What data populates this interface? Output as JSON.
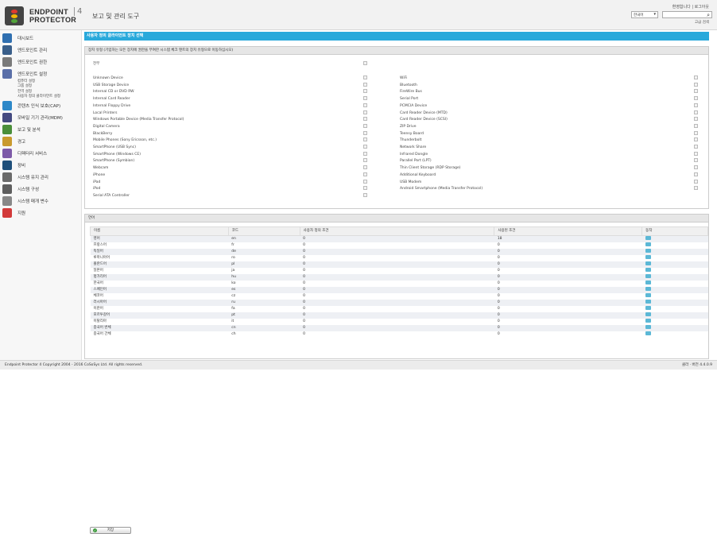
{
  "header": {
    "logo_line1": "ENDPOINT",
    "logo_line2": "PROTECTOR",
    "logo_version": "4",
    "page_title": "보고 및 관리 도구",
    "user_links": "환영합니다 | 로그아웃",
    "lang_select": "한국어",
    "advanced_search": "고급 검색"
  },
  "sidebar": {
    "items": [
      {
        "label": "대시보드",
        "icon": "dashboard-icon",
        "color": "#2f6fb0"
      },
      {
        "label": "엔드포인트 관리",
        "icon": "monitor-icon",
        "color": "#3a5f8a"
      },
      {
        "label": "엔드포인트 권한",
        "icon": "devices-icon",
        "color": "#7a7a7a"
      },
      {
        "label": "엔드포인트 설정",
        "icon": "tools-icon",
        "color": "#5a6fa8"
      }
    ],
    "sub_items": [
      "컴퓨터 설정",
      "그룹 설정",
      "전역 설정",
      "사용자 정의 클라이언트 설정"
    ],
    "items2": [
      {
        "label": "콘텐츠 인식 보호(CAP)",
        "icon": "cap-icon",
        "color": "#2d88c8"
      },
      {
        "label": "모바일 기기 관리(MDM)",
        "icon": "tablet-icon",
        "color": "#444a80"
      },
      {
        "label": "보고 및 분석",
        "icon": "chart-icon",
        "color": "#4a8e3a"
      },
      {
        "label": "경고",
        "icon": "alert-icon",
        "color": "#c99a2e"
      },
      {
        "label": "디렉터리 서비스",
        "icon": "directory-icon",
        "color": "#7d5aa8"
      },
      {
        "label": "장비",
        "icon": "appliance-icon",
        "color": "#1e4f7a"
      },
      {
        "label": "시스템 유지 관리",
        "icon": "wrench-icon",
        "color": "#6a6a6a"
      },
      {
        "label": "시스템 구성",
        "icon": "gear-icon",
        "color": "#5e5e5e"
      },
      {
        "label": "시스템 매개 변수",
        "icon": "parameters-icon",
        "color": "#888888"
      },
      {
        "label": "지원",
        "icon": "support-icon",
        "color": "#d23a3a"
      }
    ]
  },
  "main": {
    "section_title": "사용자 정의 클라이언트 장치 선택",
    "device_box_title": "장치 유형 (기입하는 모든 장치에 권한을 부여한 시스템 체크 텐트의 장치 유형으로 이동하십시오)",
    "all_label": "전부",
    "devices_left": [
      "Unknown Device",
      "USB Storage Device",
      "Internal CD or DVD RW",
      "Internal Card Reader",
      "Internal Floppy Drive",
      "Local Printers",
      "Windows Portable Device (Media Transfer Protocol)",
      "Digital Camera",
      "BlackBerry",
      "Mobile Phones (Sony Ericsson, etc.)",
      "SmartPhone (USB Sync)",
      "SmartPhone (Windows CE)",
      "SmartPhone (Symbian)",
      "Webcam",
      "iPhone",
      "iPad",
      "iPod",
      "Serial ATA Controller"
    ],
    "devices_right": [
      "WiFi",
      "Bluetooth",
      "FireWire Bus",
      "Serial Port",
      "PCMCIA Device",
      "Card Reader Device (MTD)",
      "Card Reader Device (SCSI)",
      "ZIP Drive",
      "Teensy Board",
      "Thunderbolt",
      "Network Share",
      "Infrared Dongle",
      "Parallel Port (LPT)",
      "Thin Client Storage (RDP Storage)",
      "Additional Keyboard",
      "USB Modem",
      "Android Smartphone (Media Transfer Protocol)"
    ],
    "lang_box_title": "언어",
    "lang_table": {
      "headers": [
        "이름",
        "코드",
        "사용자 정의 조건",
        "사용된 조건",
        "동작"
      ],
      "rows": [
        [
          "영어",
          "en",
          "0",
          "18"
        ],
        [
          "프랑스어",
          "fr",
          "0",
          "0"
        ],
        [
          "독일어",
          "de",
          "0",
          "0"
        ],
        [
          "루마니아어",
          "ro",
          "0",
          "0"
        ],
        [
          "폴란드어",
          "pl",
          "0",
          "0"
        ],
        [
          "일본어",
          "ja",
          "0",
          "0"
        ],
        [
          "헝가리어",
          "hu",
          "0",
          "0"
        ],
        [
          "한국어",
          "ko",
          "0",
          "0"
        ],
        [
          "스페인어",
          "es",
          "0",
          "0"
        ],
        [
          "체코어",
          "cz",
          "0",
          "0"
        ],
        [
          "러시아어",
          "ru",
          "0",
          "0"
        ],
        [
          "이란어",
          "fa",
          "0",
          "0"
        ],
        [
          "포르투갈어",
          "pt",
          "0",
          "0"
        ],
        [
          "이탈리아",
          "it",
          "0",
          "0"
        ],
        [
          "중국어 번체",
          "cn",
          "0",
          "0"
        ],
        [
          "중국어 간체",
          "ch",
          "0",
          "0"
        ]
      ]
    },
    "save_label": "저장"
  },
  "footer": {
    "left": "Endpoint Protector 4 Copyright 2004 - 2016 CoSoSys Ltd. All rights reserved.",
    "right": "클라 · 버전 4.4.0.9"
  }
}
